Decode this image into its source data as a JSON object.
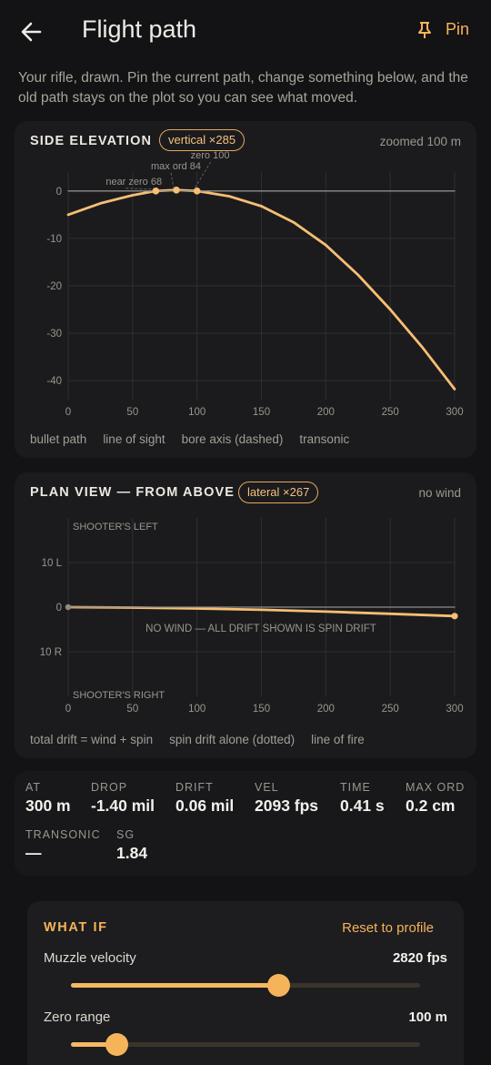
{
  "header": {
    "title": "Flight path",
    "pin_label": "Pin"
  },
  "intro": "Your rifle, drawn. Pin the current path, change something below, and the old path stays on the plot so you can see what moved.",
  "side_elevation": {
    "title": "SIDE ELEVATION",
    "chip": "vertical ×285",
    "note": "zoomed 100 m",
    "annotations": [
      "zero 100",
      "max ord 84",
      "near zero 68"
    ],
    "legend": [
      "bullet path",
      "line of sight",
      "bore axis (dashed)",
      "transonic"
    ]
  },
  "plan_view": {
    "title": "PLAN VIEW — FROM ABOVE",
    "chip": "lateral ×267",
    "note": "no wind",
    "left_label": "SHOOTER'S LEFT",
    "right_label": "SHOOTER'S RIGHT",
    "center_note": "NO WIND — ALL DRIFT SHOWN IS SPIN DRIFT",
    "legend": [
      "total drift = wind + spin",
      "spin drift alone (dotted)",
      "line of fire"
    ]
  },
  "chart_data": [
    {
      "type": "line",
      "title": "SIDE ELEVATION",
      "xlabel": "",
      "ylabel": "",
      "xlim": [
        0,
        300
      ],
      "ylim": [
        -44,
        4
      ],
      "xticks": [
        0,
        50,
        100,
        150,
        200,
        250,
        300
      ],
      "yticks": [
        0,
        -10,
        -20,
        -30,
        -40
      ],
      "ytick_labels": [
        "0",
        "-10",
        "-20",
        "-30",
        "-40"
      ],
      "grid": true,
      "series": [
        {
          "name": "bullet path",
          "color": "#f6bf73",
          "x": [
            0,
            25,
            50,
            68,
            84,
            100,
            125,
            150,
            175,
            200,
            225,
            250,
            275,
            300
          ],
          "y": [
            -5.0,
            -2.6,
            -0.9,
            0,
            0.2,
            0,
            -1.1,
            -3.2,
            -6.6,
            -11.4,
            -17.7,
            -25.0,
            -33.0,
            -41.8
          ]
        },
        {
          "name": "line of sight",
          "color": "#8f8c86",
          "x": [
            0,
            300
          ],
          "y": [
            0,
            0
          ]
        }
      ],
      "markers": [
        {
          "label": "near zero 68",
          "x": 68,
          "y": 0
        },
        {
          "label": "max ord 84",
          "x": 84,
          "y": 0.2
        },
        {
          "label": "zero 100",
          "x": 100,
          "y": 0
        }
      ]
    },
    {
      "type": "line",
      "title": "PLAN VIEW — FROM ABOVE",
      "xlabel": "",
      "ylabel": "",
      "xlim": [
        0,
        300
      ],
      "ylim": [
        -20,
        20
      ],
      "xticks": [
        0,
        50,
        100,
        150,
        200,
        250,
        300
      ],
      "yticks": [
        10,
        0,
        -10
      ],
      "ytick_labels": [
        "10 L",
        "0",
        "10 R"
      ],
      "grid": true,
      "series": [
        {
          "name": "total drift",
          "color": "#f6bf73",
          "x": [
            0,
            50,
            100,
            150,
            200,
            250,
            300
          ],
          "y": [
            0,
            -0.1,
            -0.3,
            -0.6,
            -1.0,
            -1.5,
            -2.0
          ]
        },
        {
          "name": "line of fire",
          "color": "#8f8c86",
          "x": [
            0,
            300
          ],
          "y": [
            0,
            0
          ]
        }
      ]
    }
  ],
  "stats": [
    {
      "label": "AT",
      "value": "300 m"
    },
    {
      "label": "DROP",
      "value": "-1.40 mil"
    },
    {
      "label": "DRIFT",
      "value": "0.06 mil"
    },
    {
      "label": "VEL",
      "value": "2093 fps"
    },
    {
      "label": "TIME",
      "value": "0.41 s"
    },
    {
      "label": "MAX ORD",
      "value": "0.2 cm"
    },
    {
      "label": "TRANSONIC",
      "value": "—"
    },
    {
      "label": "SG",
      "value": "1.84"
    }
  ],
  "what_if": {
    "title": "WHAT IF",
    "reset_label": "Reset to profile",
    "sliders": [
      {
        "label": "Muzzle velocity",
        "value": "2820 fps",
        "fraction": 0.595
      },
      {
        "label": "Zero range",
        "value": "100 m",
        "fraction": 0.13
      }
    ]
  },
  "colors": {
    "accent": "#f6b45a",
    "path": "#f6bf73",
    "background": "#131315",
    "card": "#1b1b1e"
  }
}
